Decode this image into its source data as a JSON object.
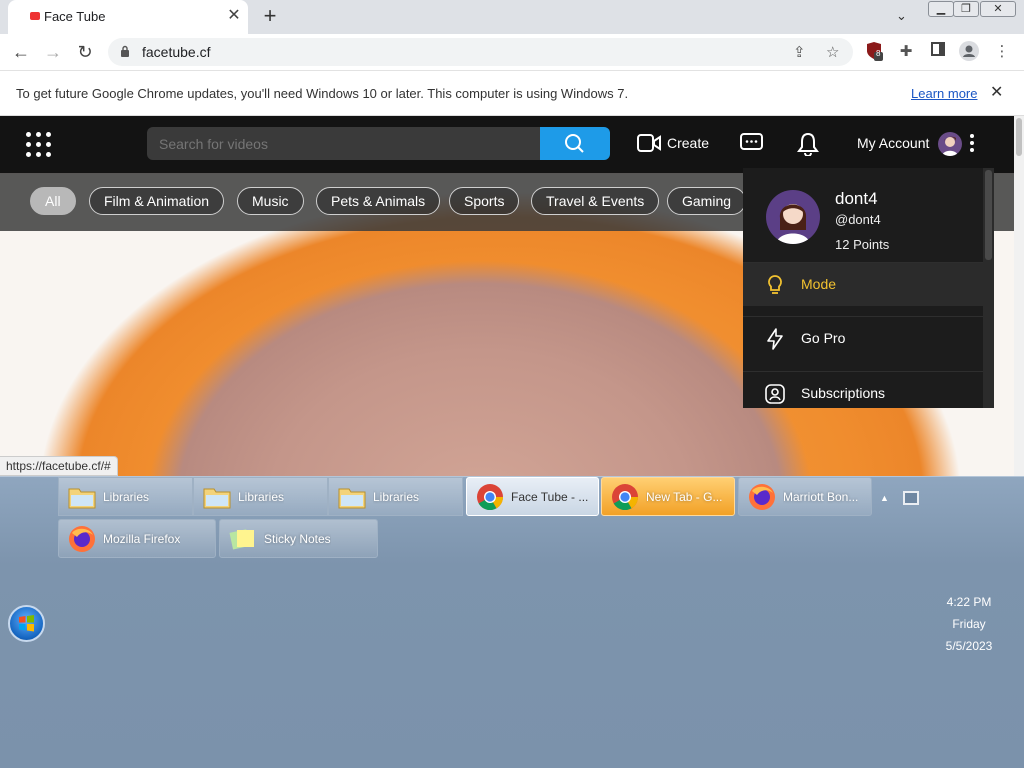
{
  "browser": {
    "tab_title": "Face Tube",
    "tab_close": "✕",
    "new_tab": "+",
    "tab_search": "⌄",
    "window_controls": {
      "minimize": "▁",
      "restore": "❐",
      "close": "✕"
    },
    "url": "facetube.cf",
    "infobar": {
      "text": "To get future Google Chrome updates, you'll need Windows 10 or later. This computer is using Windows 7.",
      "link": "Learn more",
      "close": "✕"
    },
    "extension_badge": "8",
    "status_url": "https://facetube.cf/#"
  },
  "site": {
    "search_placeholder": "Search for videos",
    "create_label": "Create",
    "account_label": "My Account",
    "chips": [
      "All",
      "Film & Animation",
      "Music",
      "Pets & Animals",
      "Sports",
      "Travel & Events",
      "Gaming"
    ],
    "active_chip": "All"
  },
  "dropdown": {
    "name": "dont4",
    "handle": "@dont4",
    "points": "12 Points",
    "items": [
      {
        "label": "Mode",
        "icon": "lightbulb-icon",
        "highlighted": true
      },
      {
        "label": "Go Pro",
        "icon": "lightning-icon",
        "highlighted": false
      },
      {
        "label": "Subscriptions",
        "icon": "subscriptions-icon",
        "highlighted": false
      }
    ]
  },
  "taskbar": {
    "buttons_row1": [
      {
        "label": "Libraries",
        "icon": "folder-icon"
      },
      {
        "label": "Libraries",
        "icon": "folder-icon"
      },
      {
        "label": "Libraries",
        "icon": "folder-icon"
      },
      {
        "label": "Face Tube - ...",
        "icon": "chrome-icon"
      },
      {
        "label": "New Tab - G...",
        "icon": "chrome-icon"
      },
      {
        "label": "Marriott Bon...",
        "icon": "firefox-icon"
      }
    ],
    "buttons_row2": [
      {
        "label": "Mozilla Firefox",
        "icon": "firefox-icon"
      },
      {
        "label": "Sticky Notes",
        "icon": "sticky-notes-icon"
      }
    ],
    "clock": {
      "time": "4:22 PM",
      "day": "Friday",
      "date": "5/5/2023"
    }
  },
  "colors": {
    "accent_blue": "#1e9be8",
    "mode_yellow": "#f2c230",
    "header_bg": "#131313"
  }
}
